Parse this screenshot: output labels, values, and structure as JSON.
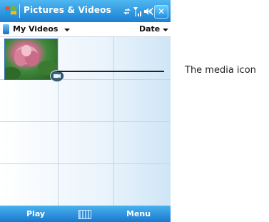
{
  "window": {
    "title": "Pictures & Videos",
    "close_label": "✕",
    "status_icons": [
      "connectivity-icon",
      "signal-icon",
      "volume-icon"
    ]
  },
  "menu": {
    "folder_label": "My Videos",
    "sort_label": "Date"
  },
  "thumbnails": [
    {
      "name": "lotus-flower-video",
      "badge_icon": "media-icon"
    }
  ],
  "softkeys": {
    "left": "Play",
    "right": "Menu",
    "center_icon": "keyboard-icon"
  },
  "callout": {
    "label": "The media icon"
  },
  "colors": {
    "title_bar": "#1b7fd2",
    "softkey_bar": "#1a78cf",
    "grid_line": "#c5d3de"
  }
}
